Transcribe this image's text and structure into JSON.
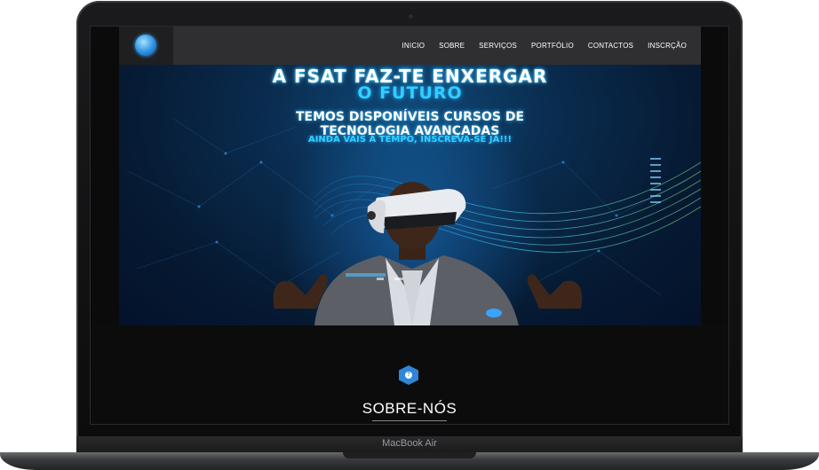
{
  "device": {
    "model_label": "MacBook Air"
  },
  "nav": {
    "links": [
      "INICIO",
      "SOBRE",
      "SERVIÇOS",
      "PORTFÓLIO",
      "CONTACTOS",
      "INSCRÇÃO"
    ]
  },
  "hero": {
    "line1": "A FSAT FAZ-TE ENXERGAR",
    "line2": "O FUTURO",
    "line3a": "TEMOS DISPONÍVEIS CURSOS DE",
    "line3b": "TECNOLOGIA AVANÇADAS",
    "line4": "AINDA VAIS A TEMPO, INSCREVA-SE JÁ!!!"
  },
  "about": {
    "icon_glyph": "?",
    "title": "SOBRE-NÓS"
  },
  "colors": {
    "accent": "#2fd0ff",
    "nav_bg": "#2f2f31",
    "page_bg": "#0c0c0d",
    "icon_blue": "#2f86d8"
  }
}
